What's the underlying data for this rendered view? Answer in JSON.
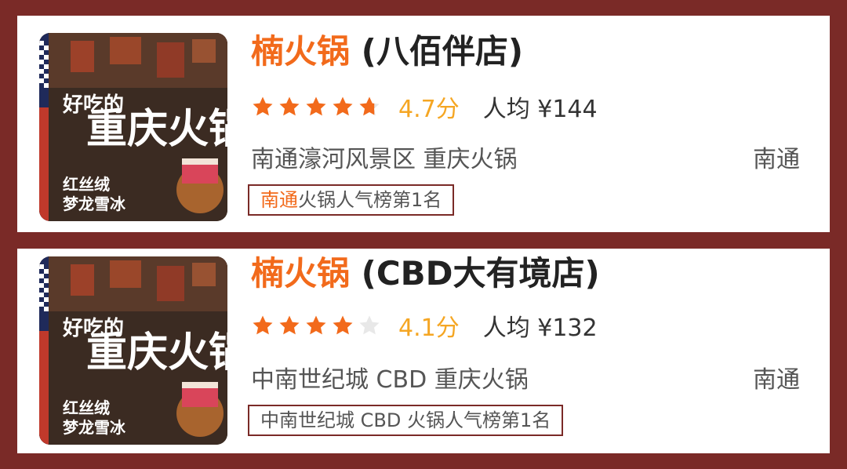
{
  "colors": {
    "frame": "#7a2a27",
    "brand": "#f26a1b",
    "star": "#f26a1b",
    "score": "#f5a623"
  },
  "listings": [
    {
      "name": "楠火锅",
      "branch": "(八佰伴店)",
      "rating": 4.7,
      "score_text": "4.7分",
      "per_capita": "人均 ¥144",
      "area": "南通濠河风景区  重庆火锅",
      "city": "南通",
      "rank_highlight": "南通",
      "rank_rest": "火锅人气榜第1名",
      "image": {
        "big_text": "重庆火锅",
        "small_text": "好吃的",
        "promo": [
          "红丝绒",
          "梦龙雪冰"
        ]
      }
    },
    {
      "name": "楠火锅",
      "branch": "(CBD大有境店)",
      "rating": 4.1,
      "score_text": "4.1分",
      "per_capita": "人均 ¥132",
      "area": "中南世纪城 CBD  重庆火锅",
      "city": "南通",
      "rank_highlight": "",
      "rank_rest": "中南世纪城 CBD 火锅人气榜第1名",
      "image": {
        "big_text": "重庆火锅",
        "small_text": "好吃的",
        "promo": [
          "红丝绒",
          "梦龙雪冰"
        ]
      }
    }
  ]
}
